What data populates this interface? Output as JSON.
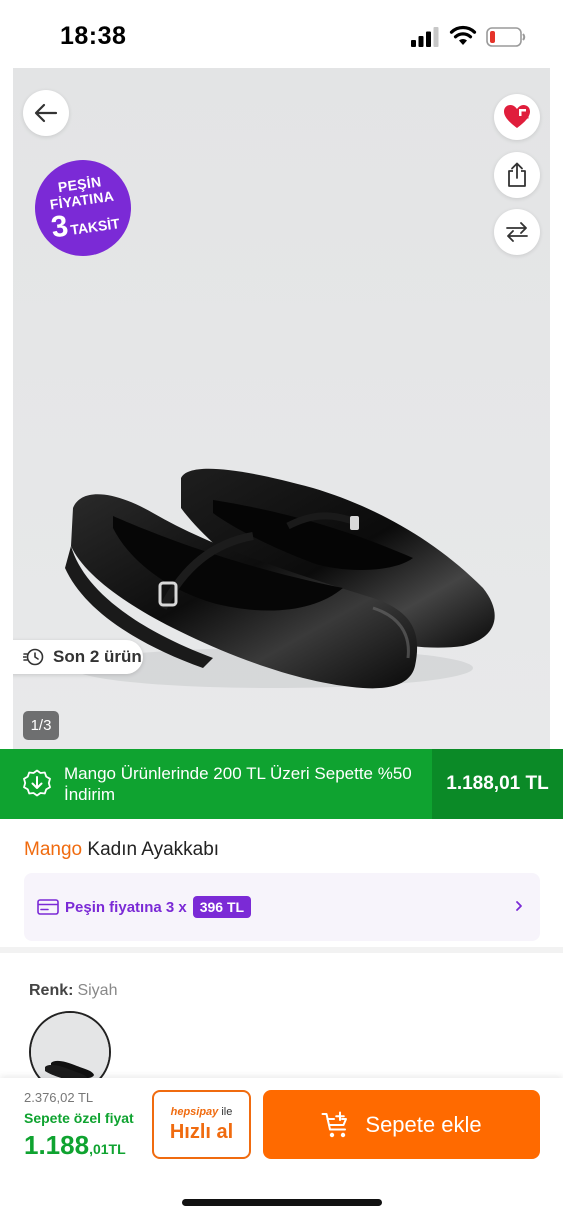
{
  "status_bar": {
    "time": "18:38"
  },
  "gallery": {
    "badge": {
      "line1": "PEŞİN",
      "line2": "FİYATINA",
      "number": "3",
      "word": "TAKSİT"
    },
    "stock_chip": "Son 2 ürün",
    "page_indicator": "1/3"
  },
  "campaign": {
    "text": "Mango Ürünlerinde 200 TL Üzeri Sepette %50 İndirim",
    "price": "1.188,01 TL"
  },
  "product": {
    "brand": "Mango",
    "title": "Kadın Ayakkabı"
  },
  "installment": {
    "text": "Peşin fiyatına 3 x",
    "amount": "396 TL"
  },
  "color": {
    "label": "Renk:",
    "value": "Siyah"
  },
  "purchase": {
    "old_price": "2.376,02 TL",
    "special_label": "Sepete özel fiyat",
    "price_main": "1.188",
    "price_frac": ",01TL",
    "quick_brand": "hepsipay",
    "quick_suffix": "ile",
    "quick_label": "Hızlı al",
    "cart_label": "Sepete ekle"
  },
  "colors": {
    "accent": "#ff6a00",
    "brand": "#f06b0f",
    "campaign": "#0fa330",
    "installment": "#7b2ad6"
  }
}
